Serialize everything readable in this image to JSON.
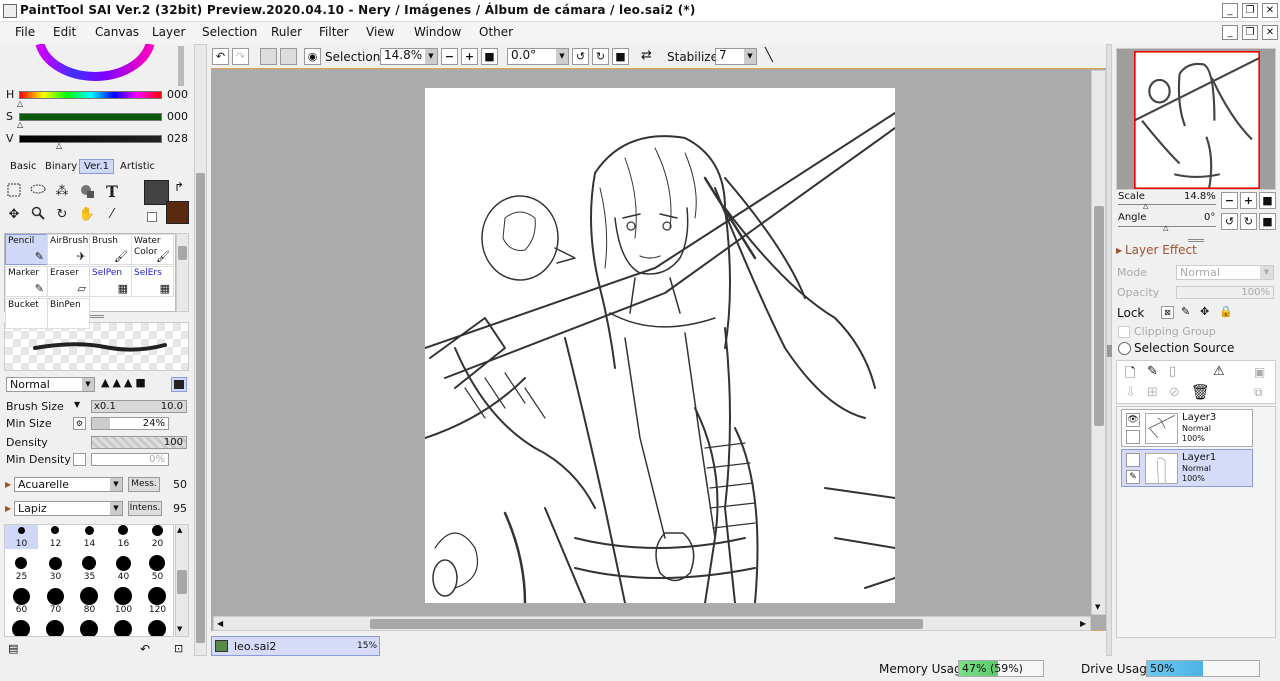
{
  "window": {
    "title": "PaintTool SAI Ver.2 (32bit) Preview.2020.04.10 - Nery / Imágenes / Álbum de cámara / leo.sai2 (*)",
    "minimize_glyph": "_",
    "restore_glyph": "❐",
    "close_glyph": "✕"
  },
  "menu": [
    "File",
    "Edit",
    "Canvas",
    "Layer",
    "Selection",
    "Ruler",
    "Filter",
    "View",
    "Window",
    "Other"
  ],
  "color": {
    "h_label": "H",
    "h_value": "000",
    "s_label": "S",
    "s_value": "000",
    "v_label": "V",
    "v_value": "028",
    "primary": "#434343",
    "secondary": "#5a2a10",
    "tabs": [
      "Basic",
      "Binary",
      "Ver.1",
      "Artistic"
    ],
    "active_tab": "Ver.1"
  },
  "brushes": [
    {
      "label": "Pencil",
      "icon": "✎"
    },
    {
      "label": "AirBrush",
      "icon": "✈"
    },
    {
      "label": "Brush",
      "icon": "🖌"
    },
    {
      "label": "Water Color",
      "icon": "🖌"
    },
    {
      "label": "Marker",
      "icon": "✎"
    },
    {
      "label": "Eraser",
      "icon": "▱"
    },
    {
      "label": "SelPen",
      "icon": "▦"
    },
    {
      "label": "SelErs",
      "icon": "▦"
    },
    {
      "label": "Bucket",
      "icon": ""
    },
    {
      "label": "BinPen",
      "icon": ""
    }
  ],
  "brush_settings": {
    "blend_mode": "Normal",
    "brush_size_label": "Brush Size",
    "brush_size_mult": "x0.1",
    "brush_size_value": "10.0",
    "min_size_label": "Min Size",
    "min_size_value": "24%",
    "min_size_fraction": 0.24,
    "density_label": "Density",
    "density_value": "100",
    "min_density_label": "Min Density",
    "min_density_value": "0%",
    "texture_name": "Acuarelle",
    "texture_param_label": "Mess.",
    "texture_param_value": "50",
    "shape_name": "Lapiz",
    "shape_param_label": "Intens.",
    "shape_param_value": "95"
  },
  "brush_sizes": [
    "10",
    "12",
    "14",
    "16",
    "20",
    "25",
    "30",
    "35",
    "40",
    "50",
    "60",
    "70",
    "80",
    "100",
    "120",
    "",
    "",
    "",
    "",
    ""
  ],
  "toolbar": {
    "selection_label": "Selection",
    "zoom": "14.8%",
    "rotation": "0.0°",
    "stabilizer_label": "Stabilizer",
    "stabilizer_value": "7"
  },
  "document_tab": {
    "name": "leo.sai2",
    "zoom": "15%"
  },
  "navigator": {
    "scale_label": "Scale",
    "scale_value": "14.8%",
    "angle_label": "Angle",
    "angle_value": "0°"
  },
  "layer_panel": {
    "section_title": "Layer Effect",
    "mode_label": "Mode",
    "mode_value": "Normal",
    "opacity_label": "Opacity",
    "opacity_value": "100%",
    "lock_label": "Lock",
    "clipping_label": "Clipping Group",
    "selection_source_label": "Selection Source",
    "layers": [
      {
        "name": "Layer3",
        "mode": "Normal",
        "opacity": "100%",
        "visible": true
      },
      {
        "name": "Layer1",
        "mode": "Normal",
        "opacity": "100%",
        "visible": false
      }
    ]
  },
  "status": {
    "memory_label": "Memory Usage",
    "memory_value": "47% (59%)",
    "memory_fraction": 0.47,
    "drive_label": "Drive Usage",
    "drive_value": "50%",
    "drive_fraction": 0.5
  }
}
